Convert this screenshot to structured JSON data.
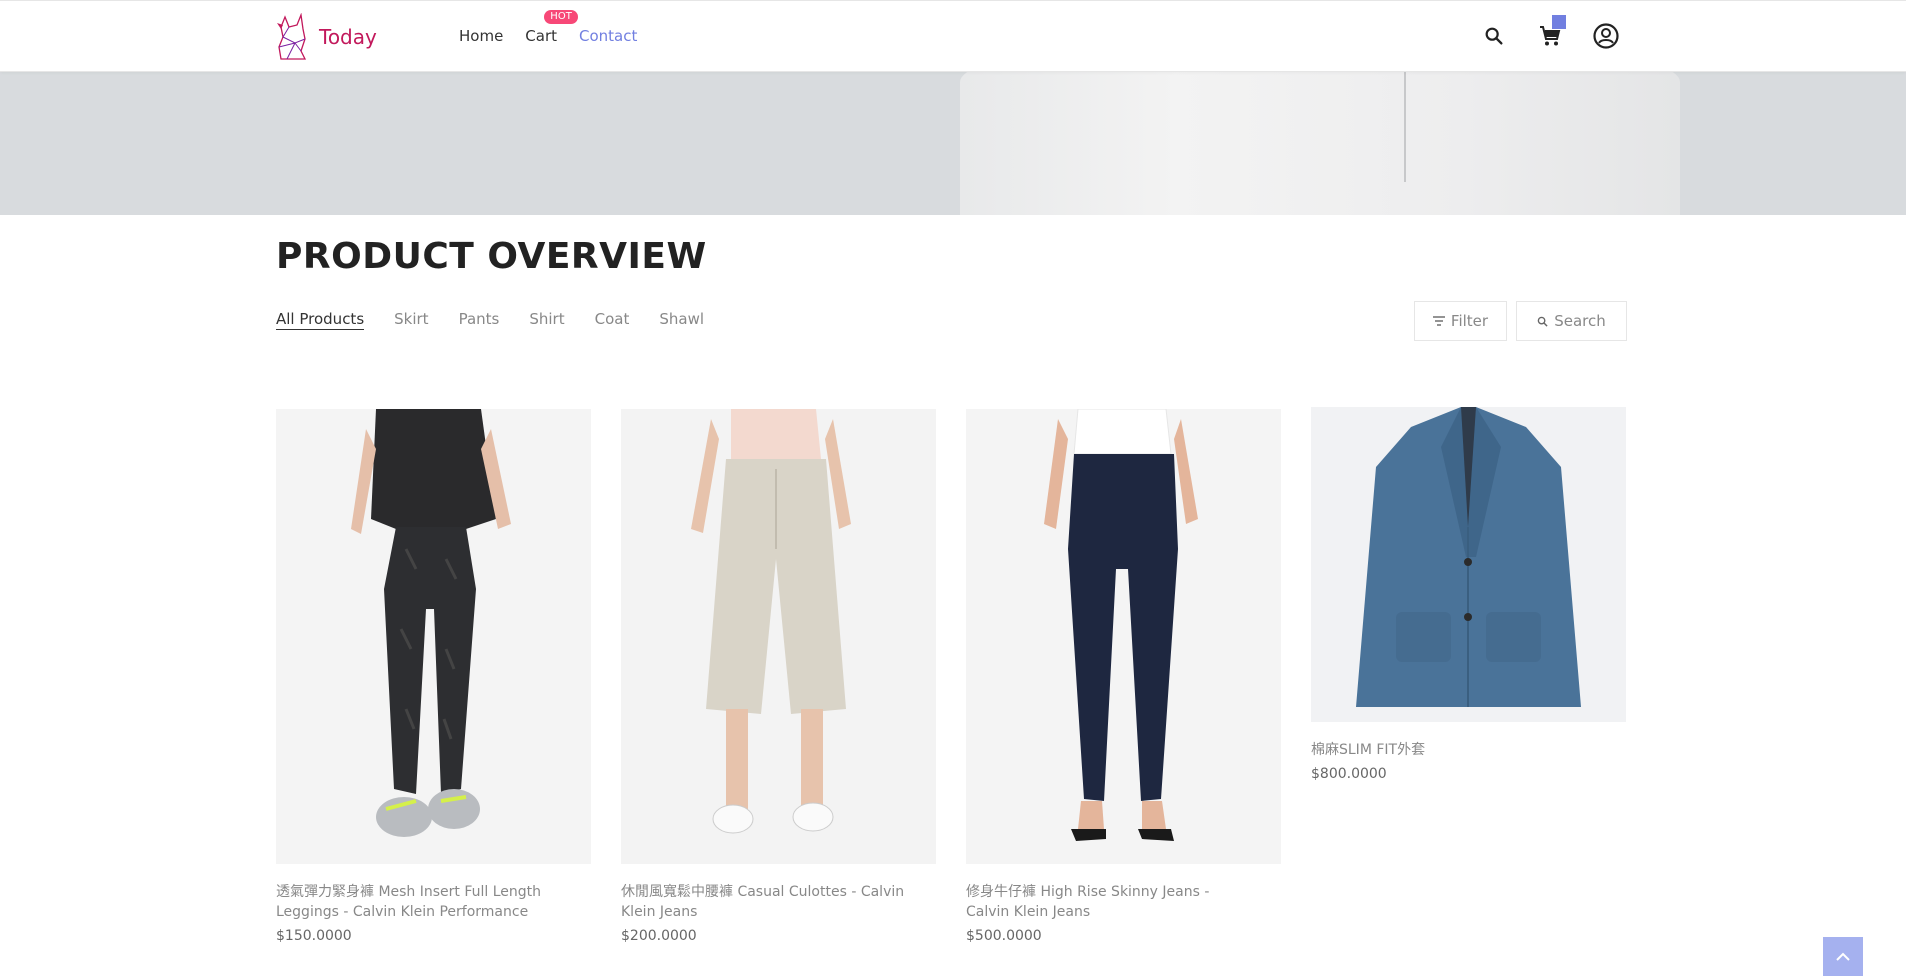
{
  "brand": {
    "name": "Today"
  },
  "nav": {
    "items": [
      {
        "label": "Home"
      },
      {
        "label": "Cart",
        "badge": "HOT"
      },
      {
        "label": "Contact"
      }
    ]
  },
  "header_icons": {
    "search": "search-icon",
    "cart": "cart-icon",
    "account": "account-icon"
  },
  "page_title": "PRODUCT OVERVIEW",
  "filters": {
    "tabs": [
      "All Products",
      "Skirt",
      "Pants",
      "Shirt",
      "Coat",
      "Shawl"
    ],
    "filter_label": "Filter",
    "search_label": "Search"
  },
  "products": [
    {
      "name": "透氣彈力緊身褲 Mesh Insert Full Length Leggings - Calvin Klein Performance",
      "price": "$150.0000"
    },
    {
      "name": "休閒風寬鬆中腰褲 Casual Culottes - Calvin Klein Jeans",
      "price": "$200.0000"
    },
    {
      "name": "修身牛仔褲 High Rise Skinny Jeans - Calvin Klein Jeans",
      "price": "$500.0000"
    },
    {
      "name": "棉麻SLIM FIT外套",
      "price": "$800.0000"
    }
  ],
  "colors": {
    "accent": "#717fe0",
    "hot_badge": "#f74877",
    "brand": "#c2185b"
  }
}
